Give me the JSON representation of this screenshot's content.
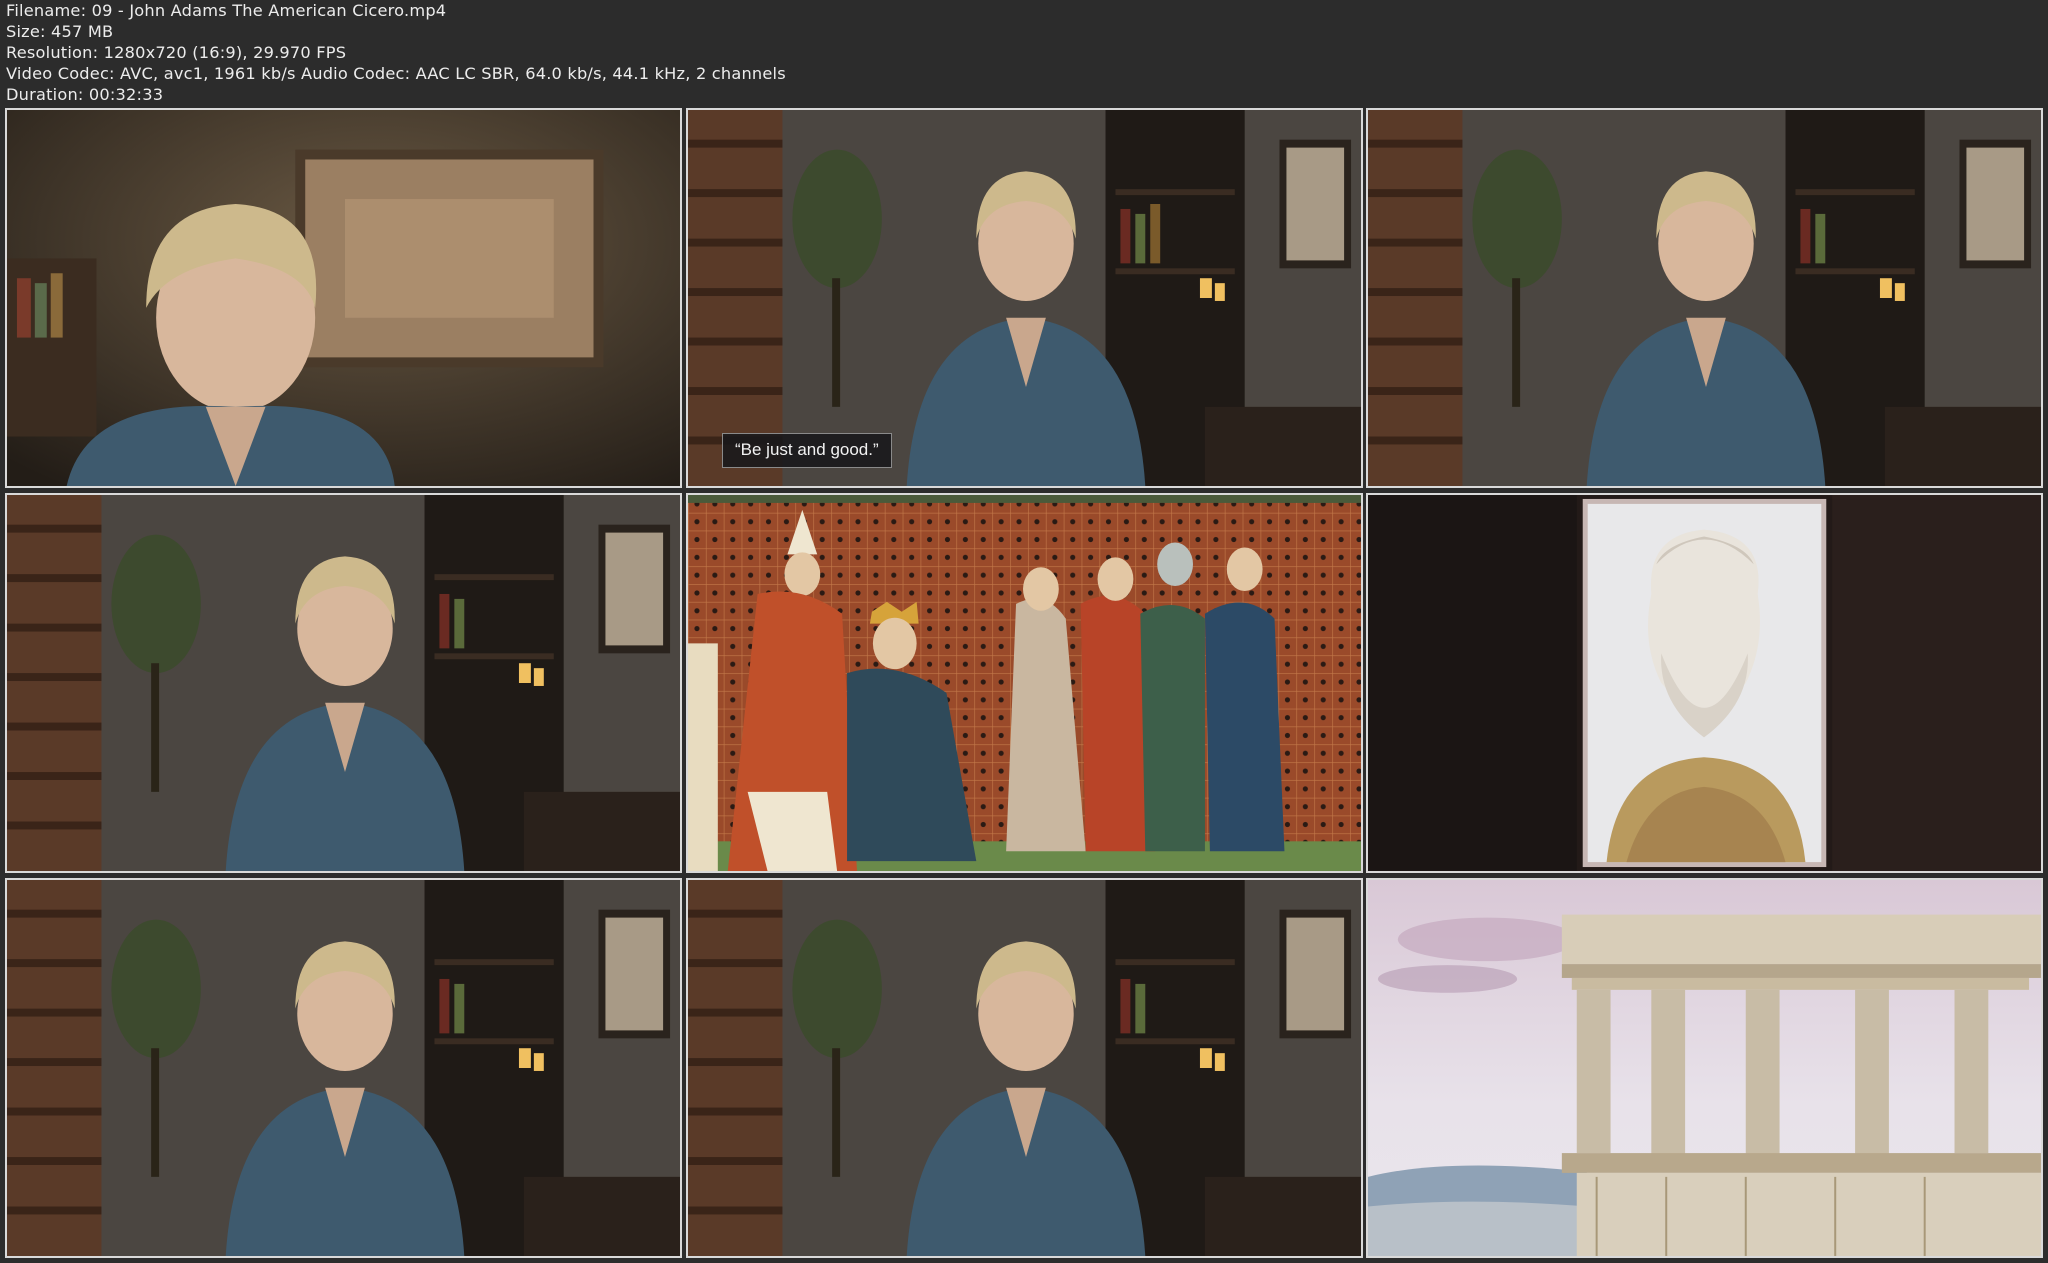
{
  "info": {
    "filename": "Filename: 09 - John Adams The American Cicero.mp4",
    "size": "Size: 457 MB",
    "resolution": "Resolution: 1280x720 (16:9), 29.970 FPS",
    "codec": "Video Codec: AVC, avc1, 1961 kb/s Audio Codec: AAC LC SBR, 64.0 kb/s, 44.1 kHz, 2 channels",
    "duration": "Duration: 00:32:33"
  },
  "frames": [
    {
      "kind": "speaker-closeup"
    },
    {
      "kind": "speaker-wide",
      "caption": "“Be just and good.”"
    },
    {
      "kind": "speaker-wide"
    },
    {
      "kind": "speaker-wide"
    },
    {
      "kind": "medieval-illustration"
    },
    {
      "kind": "bust-portrait"
    },
    {
      "kind": "speaker-wide"
    },
    {
      "kind": "speaker-wide"
    },
    {
      "kind": "temple-ruins"
    }
  ],
  "colors": {
    "background": "#2c2c2c",
    "thumb_border": "#d9d9d9",
    "text": "#ececec"
  }
}
